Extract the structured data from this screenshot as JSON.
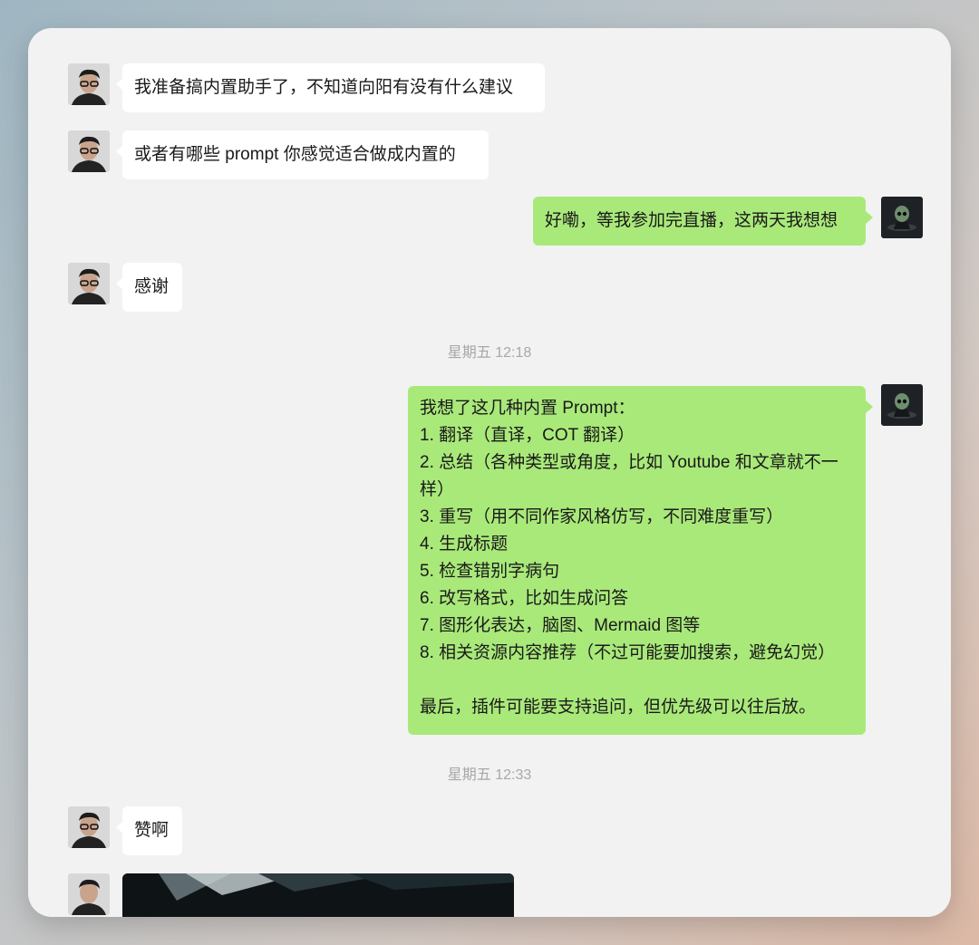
{
  "messages": [
    {
      "text": "我准备搞内置助手了，不知道向阳有没有什么建议"
    },
    {
      "text": "或者有哪些 prompt 你感觉适合做成内置的"
    },
    {
      "text": "好嘞，等我参加完直播，这两天我想想"
    },
    {
      "text": "感谢"
    },
    {
      "lines": [
        "我想了这几种内置 Prompt：",
        "1. 翻译（直译，COT 翻译）",
        "2. 总结（各种类型或角度，比如 Youtube 和文章就不一",
        "样）",
        "3. 重写（用不同作家风格仿写，不同难度重写）",
        "4. 生成标题",
        "5. 检查错别字病句",
        "6. 改写格式，比如生成问答",
        "7. 图形化表达，脑图、Mermaid 图等",
        "8.  相关资源内容推荐（不过可能要加搜索，避免幻觉）",
        "",
        "最后，插件可能要支持追问，但优先级可以往后放。"
      ]
    },
    {
      "text": "赞啊"
    }
  ],
  "timestamps": [
    "星期五 12:18",
    "星期五 12:33"
  ],
  "icons": {
    "contact_avatar": "person-avatar",
    "self_avatar": "alien-avatar",
    "image_message": "image-thumbnail"
  },
  "colors": {
    "bubble_out": "#a9e97a",
    "bubble_in": "#ffffff",
    "window_bg": "#f2f2f2"
  }
}
